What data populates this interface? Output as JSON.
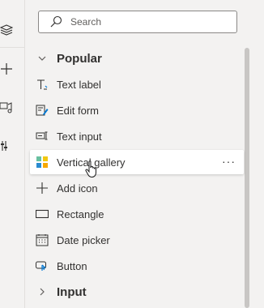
{
  "search": {
    "placeholder": "Search"
  },
  "groups": {
    "popular": "Popular",
    "input": "Input"
  },
  "items": [
    {
      "label": "Text label",
      "icon": "text-label-icon"
    },
    {
      "label": "Edit form",
      "icon": "edit-form-icon"
    },
    {
      "label": "Text input",
      "icon": "text-input-icon"
    },
    {
      "label": "Vertical gallery",
      "icon": "vertical-gallery-icon",
      "selected": true
    },
    {
      "label": "Add icon",
      "icon": "plus-icon"
    },
    {
      "label": "Rectangle",
      "icon": "rectangle-icon"
    },
    {
      "label": "Date picker",
      "icon": "calendar-icon"
    },
    {
      "label": "Button",
      "icon": "button-icon"
    }
  ],
  "more_menu": "···",
  "rail": [
    "layers-icon",
    "insert-icon",
    "media-icon",
    "tools-icon"
  ]
}
